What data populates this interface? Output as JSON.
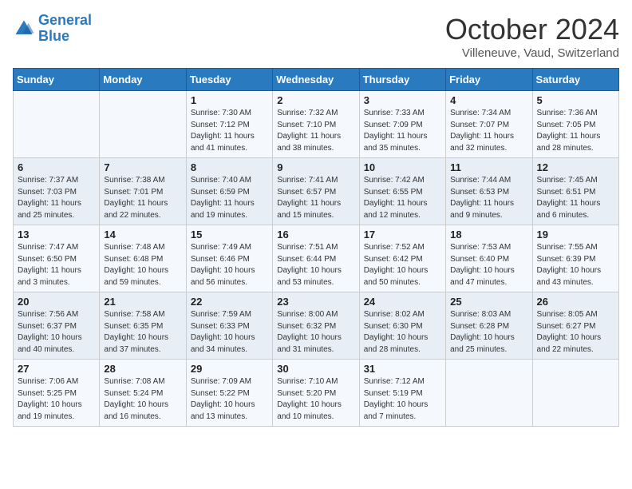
{
  "header": {
    "logo_line1": "General",
    "logo_line2": "Blue",
    "month_title": "October 2024",
    "location": "Villeneuve, Vaud, Switzerland"
  },
  "days_of_week": [
    "Sunday",
    "Monday",
    "Tuesday",
    "Wednesday",
    "Thursday",
    "Friday",
    "Saturday"
  ],
  "weeks": [
    [
      {
        "day": "",
        "info": ""
      },
      {
        "day": "",
        "info": ""
      },
      {
        "day": "1",
        "info": "Sunrise: 7:30 AM\nSunset: 7:12 PM\nDaylight: 11 hours and 41 minutes."
      },
      {
        "day": "2",
        "info": "Sunrise: 7:32 AM\nSunset: 7:10 PM\nDaylight: 11 hours and 38 minutes."
      },
      {
        "day": "3",
        "info": "Sunrise: 7:33 AM\nSunset: 7:09 PM\nDaylight: 11 hours and 35 minutes."
      },
      {
        "day": "4",
        "info": "Sunrise: 7:34 AM\nSunset: 7:07 PM\nDaylight: 11 hours and 32 minutes."
      },
      {
        "day": "5",
        "info": "Sunrise: 7:36 AM\nSunset: 7:05 PM\nDaylight: 11 hours and 28 minutes."
      }
    ],
    [
      {
        "day": "6",
        "info": "Sunrise: 7:37 AM\nSunset: 7:03 PM\nDaylight: 11 hours and 25 minutes."
      },
      {
        "day": "7",
        "info": "Sunrise: 7:38 AM\nSunset: 7:01 PM\nDaylight: 11 hours and 22 minutes."
      },
      {
        "day": "8",
        "info": "Sunrise: 7:40 AM\nSunset: 6:59 PM\nDaylight: 11 hours and 19 minutes."
      },
      {
        "day": "9",
        "info": "Sunrise: 7:41 AM\nSunset: 6:57 PM\nDaylight: 11 hours and 15 minutes."
      },
      {
        "day": "10",
        "info": "Sunrise: 7:42 AM\nSunset: 6:55 PM\nDaylight: 11 hours and 12 minutes."
      },
      {
        "day": "11",
        "info": "Sunrise: 7:44 AM\nSunset: 6:53 PM\nDaylight: 11 hours and 9 minutes."
      },
      {
        "day": "12",
        "info": "Sunrise: 7:45 AM\nSunset: 6:51 PM\nDaylight: 11 hours and 6 minutes."
      }
    ],
    [
      {
        "day": "13",
        "info": "Sunrise: 7:47 AM\nSunset: 6:50 PM\nDaylight: 11 hours and 3 minutes."
      },
      {
        "day": "14",
        "info": "Sunrise: 7:48 AM\nSunset: 6:48 PM\nDaylight: 10 hours and 59 minutes."
      },
      {
        "day": "15",
        "info": "Sunrise: 7:49 AM\nSunset: 6:46 PM\nDaylight: 10 hours and 56 minutes."
      },
      {
        "day": "16",
        "info": "Sunrise: 7:51 AM\nSunset: 6:44 PM\nDaylight: 10 hours and 53 minutes."
      },
      {
        "day": "17",
        "info": "Sunrise: 7:52 AM\nSunset: 6:42 PM\nDaylight: 10 hours and 50 minutes."
      },
      {
        "day": "18",
        "info": "Sunrise: 7:53 AM\nSunset: 6:40 PM\nDaylight: 10 hours and 47 minutes."
      },
      {
        "day": "19",
        "info": "Sunrise: 7:55 AM\nSunset: 6:39 PM\nDaylight: 10 hours and 43 minutes."
      }
    ],
    [
      {
        "day": "20",
        "info": "Sunrise: 7:56 AM\nSunset: 6:37 PM\nDaylight: 10 hours and 40 minutes."
      },
      {
        "day": "21",
        "info": "Sunrise: 7:58 AM\nSunset: 6:35 PM\nDaylight: 10 hours and 37 minutes."
      },
      {
        "day": "22",
        "info": "Sunrise: 7:59 AM\nSunset: 6:33 PM\nDaylight: 10 hours and 34 minutes."
      },
      {
        "day": "23",
        "info": "Sunrise: 8:00 AM\nSunset: 6:32 PM\nDaylight: 10 hours and 31 minutes."
      },
      {
        "day": "24",
        "info": "Sunrise: 8:02 AM\nSunset: 6:30 PM\nDaylight: 10 hours and 28 minutes."
      },
      {
        "day": "25",
        "info": "Sunrise: 8:03 AM\nSunset: 6:28 PM\nDaylight: 10 hours and 25 minutes."
      },
      {
        "day": "26",
        "info": "Sunrise: 8:05 AM\nSunset: 6:27 PM\nDaylight: 10 hours and 22 minutes."
      }
    ],
    [
      {
        "day": "27",
        "info": "Sunrise: 7:06 AM\nSunset: 5:25 PM\nDaylight: 10 hours and 19 minutes."
      },
      {
        "day": "28",
        "info": "Sunrise: 7:08 AM\nSunset: 5:24 PM\nDaylight: 10 hours and 16 minutes."
      },
      {
        "day": "29",
        "info": "Sunrise: 7:09 AM\nSunset: 5:22 PM\nDaylight: 10 hours and 13 minutes."
      },
      {
        "day": "30",
        "info": "Sunrise: 7:10 AM\nSunset: 5:20 PM\nDaylight: 10 hours and 10 minutes."
      },
      {
        "day": "31",
        "info": "Sunrise: 7:12 AM\nSunset: 5:19 PM\nDaylight: 10 hours and 7 minutes."
      },
      {
        "day": "",
        "info": ""
      },
      {
        "day": "",
        "info": ""
      }
    ]
  ]
}
